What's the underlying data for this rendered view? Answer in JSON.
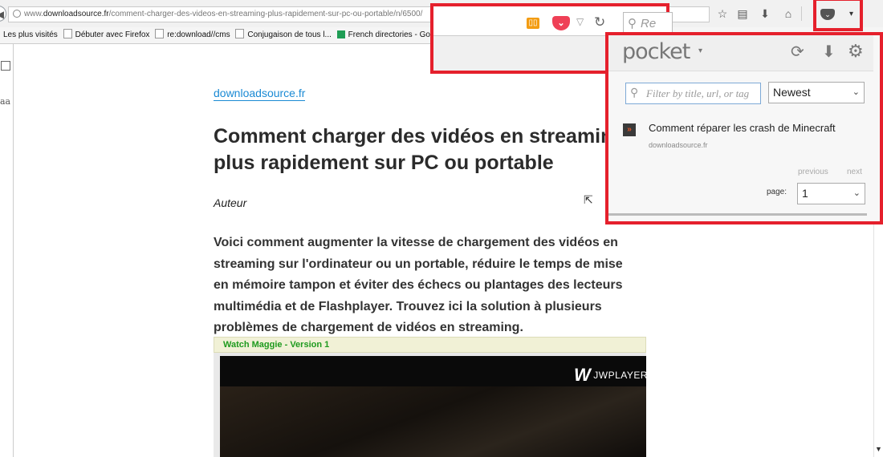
{
  "browser": {
    "url_prefix": "www.",
    "url_domain": "downloadsource.fr",
    "url_path": "/comment-charger-des-videos-en-streaming-plus-rapidement-sur-pc-ou-portable/n/6500/",
    "search_placeholder": "Re",
    "bookmarks": [
      {
        "label": "Les plus visités",
        "icon": "none"
      },
      {
        "label": "Débuter avec Firefox",
        "icon": "page-icon"
      },
      {
        "label": "re:download//cms",
        "icon": "page-icon"
      },
      {
        "label": "Conjugaison de tous l...",
        "icon": "page-icon"
      },
      {
        "label": "French directories - Go...",
        "icon": "sheet-icon"
      }
    ],
    "toolbar_icons": [
      "star-icon",
      "library-icon",
      "download-icon",
      "home-icon",
      "pocket-icon",
      "menu-caret-icon"
    ]
  },
  "article": {
    "site": "downloadsource.fr",
    "title": "Comment charger des vidéos en streaming plus rapidement sur PC ou portable",
    "author": "Auteur",
    "intro": "Voici comment augmenter la vitesse de chargement des vidéos en streaming sur l'ordinateur ou un portable, réduire le temps de mise en mémoire tampon et éviter des échecs ou plantages des lecteurs multimédia et de Flashplayer. Trouvez ici la solution à plusieurs problèmes de chargement de vidéos en streaming.",
    "video_title": "Watch Maggie",
    "video_version": " - Version 1",
    "player_brand": "JWPLAYER"
  },
  "pocket": {
    "logo": "pocket",
    "filter_placeholder": "Filter by title, url, or tag",
    "sort_value": "Newest",
    "items": [
      {
        "title": "Comment réparer les crash de Minecraft",
        "domain": "downloadsource.fr"
      }
    ],
    "previous_label": "previous",
    "next_label": "next",
    "page_label": "page:",
    "page_value": "1"
  },
  "colors": {
    "highlight": "#e5202c",
    "link": "#1a8ad4",
    "pocket_red": "#ef4056"
  }
}
